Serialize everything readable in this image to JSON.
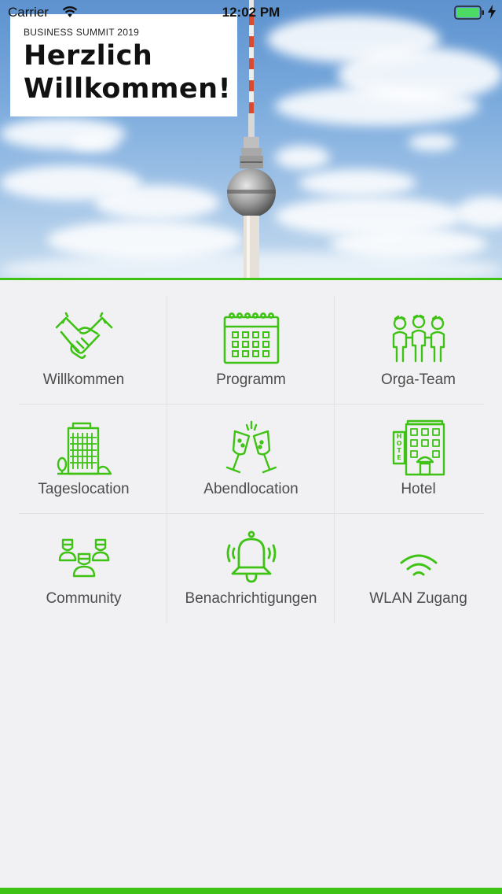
{
  "status_bar": {
    "carrier": "Carrier",
    "time": "12:02 PM"
  },
  "hero": {
    "subtitle": "BUSINESS SUMMIT 2019",
    "title": "Herzlich\nWillkommen!"
  },
  "menu": [
    {
      "label": "Willkommen",
      "icon": "handshake-icon"
    },
    {
      "label": "Programm",
      "icon": "calendar-icon"
    },
    {
      "label": "Orga-Team",
      "icon": "team-icon"
    },
    {
      "label": "Tageslocation",
      "icon": "office-building-icon"
    },
    {
      "label": "Abendlocation",
      "icon": "champagne-glasses-icon"
    },
    {
      "label": "Hotel",
      "icon": "hotel-icon"
    },
    {
      "label": "Community",
      "icon": "community-icon"
    },
    {
      "label": "Benachrichtigungen",
      "icon": "bell-icon"
    },
    {
      "label": "WLAN Zugang",
      "icon": "wifi-icon"
    }
  ],
  "colors": {
    "accent": "#3ec214",
    "background": "#f1f1f3",
    "label": "#4c4c4c"
  }
}
